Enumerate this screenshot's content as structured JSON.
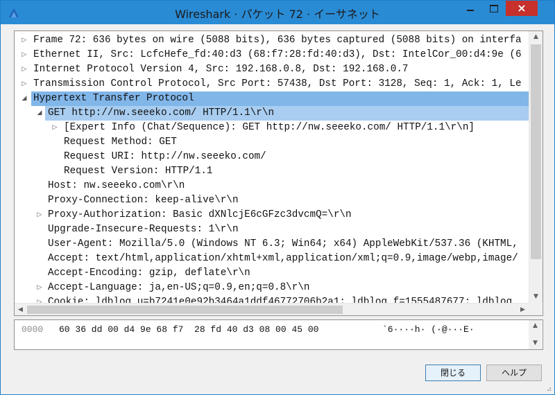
{
  "window": {
    "title": "Wireshark · パケット 72 · イーサネット",
    "accent_color": "#2a8bd5",
    "close_icon": "×"
  },
  "tree": {
    "rows": [
      {
        "text": "Frame 72: 636 bytes on wire (5088 bits), 636 bytes captured (5088 bits) on interfa",
        "indent": 0,
        "toggle": "▷",
        "state": "collapsed"
      },
      {
        "text": "Ethernet II, Src: LcfcHefe_fd:40:d3 (68:f7:28:fd:40:d3), Dst: IntelCor_00:d4:9e (6",
        "indent": 0,
        "toggle": "▷",
        "state": "collapsed"
      },
      {
        "text": "Internet Protocol Version 4, Src: 192.168.0.8, Dst: 192.168.0.7",
        "indent": 0,
        "toggle": "▷",
        "state": "collapsed"
      },
      {
        "text": "Transmission Control Protocol, Src Port: 57438, Dst Port: 3128, Seq: 1, Ack: 1, Le",
        "indent": 0,
        "toggle": "▷",
        "state": "collapsed"
      },
      {
        "text": "Hypertext Transfer Protocol",
        "indent": 0,
        "toggle": "◢",
        "state": "expanded",
        "selected": true
      },
      {
        "text": "GET http://nw.seeeko.com/ HTTP/1.1\\r\\n",
        "indent": 1,
        "toggle": "◢",
        "state": "expanded",
        "highlighted": true
      },
      {
        "text": "[Expert Info (Chat/Sequence): GET http://nw.seeeko.com/ HTTP/1.1\\r\\n]",
        "indent": 2,
        "toggle": "▷",
        "state": "collapsed"
      },
      {
        "text": "Request Method: GET",
        "indent": 2,
        "toggle": "",
        "state": "leaf"
      },
      {
        "text": "Request URI: http://nw.seeeko.com/",
        "indent": 2,
        "toggle": "",
        "state": "leaf"
      },
      {
        "text": "Request Version: HTTP/1.1",
        "indent": 2,
        "toggle": "",
        "state": "leaf"
      },
      {
        "text": "Host: nw.seeeko.com\\r\\n",
        "indent": 1,
        "toggle": "",
        "state": "leaf"
      },
      {
        "text": "Proxy-Connection: keep-alive\\r\\n",
        "indent": 1,
        "toggle": "",
        "state": "leaf"
      },
      {
        "text": "Proxy-Authorization: Basic dXNlcjE6cGFzc3dvcmQ=\\r\\n",
        "indent": 1,
        "toggle": "▷",
        "state": "collapsed"
      },
      {
        "text": "Upgrade-Insecure-Requests: 1\\r\\n",
        "indent": 1,
        "toggle": "",
        "state": "leaf"
      },
      {
        "text": "User-Agent: Mozilla/5.0 (Windows NT 6.3; Win64; x64) AppleWebKit/537.36 (KHTML,",
        "indent": 1,
        "toggle": "",
        "state": "leaf"
      },
      {
        "text": "Accept: text/html,application/xhtml+xml,application/xml;q=0.9,image/webp,image/",
        "indent": 1,
        "toggle": "",
        "state": "leaf"
      },
      {
        "text": "Accept-Encoding: gzip, deflate\\r\\n",
        "indent": 1,
        "toggle": "",
        "state": "leaf"
      },
      {
        "text": "Accept-Language: ja,en-US;q=0.9,en;q=0.8\\r\\n",
        "indent": 1,
        "toggle": "▷",
        "state": "collapsed"
      },
      {
        "text": "Cookie: ldblog_u=b7241e0e92b3464a1ddf46772706b2a1; ldblog_f=1555487677; ldblog",
        "indent": 1,
        "toggle": "▷",
        "state": "collapsed"
      }
    ],
    "scroll_up_icon": "▲",
    "scroll_down_icon": "▼",
    "scroll_left_icon": "◀",
    "scroll_right_icon": "▶"
  },
  "hex": {
    "offset": "0000",
    "bytes": "60 36 dd 00 d4 9e 68 f7  28 fd 40 d3 08 00 45 00",
    "ascii": "`6····h· (·@···E·"
  },
  "buttons": {
    "close_label": "閉じる",
    "help_label": "ヘルプ"
  }
}
